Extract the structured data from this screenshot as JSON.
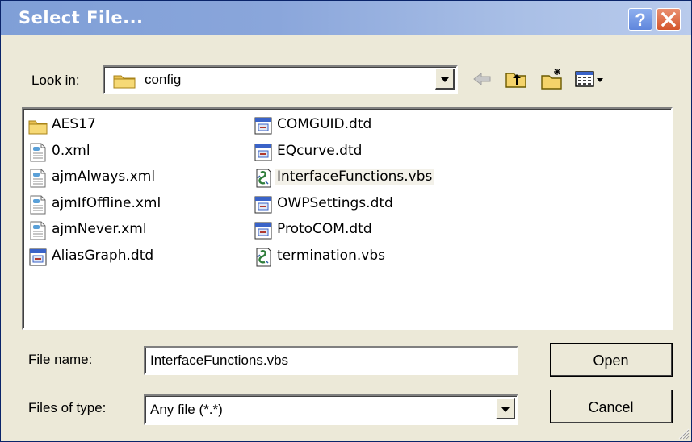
{
  "window": {
    "title": "Select File..."
  },
  "lookin": {
    "label": "Look in:",
    "value": "config"
  },
  "files": [
    {
      "name": "AES17",
      "type": "folder"
    },
    {
      "name": "0.xml",
      "type": "xml"
    },
    {
      "name": "ajmAlways.xml",
      "type": "xml"
    },
    {
      "name": "ajmIfOffline.xml",
      "type": "xml"
    },
    {
      "name": "ajmNever.xml",
      "type": "xml"
    },
    {
      "name": "AliasGraph.dtd",
      "type": "dtd"
    },
    {
      "name": "COMGUID.dtd",
      "type": "dtd"
    },
    {
      "name": "EQcurve.dtd",
      "type": "dtd"
    },
    {
      "name": "InterfaceFunctions.vbs",
      "type": "vbs",
      "selected": true
    },
    {
      "name": "OWPSettings.dtd",
      "type": "dtd"
    },
    {
      "name": "ProtoCOM.dtd",
      "type": "dtd"
    },
    {
      "name": "termination.vbs",
      "type": "vbs"
    }
  ],
  "filename": {
    "label": "File name:",
    "value": "InterfaceFunctions.vbs"
  },
  "filetype": {
    "label": "Files of type:",
    "value": "Any file (*.*)"
  },
  "buttons": {
    "open": "Open",
    "cancel": "Cancel"
  },
  "colors": {
    "titlebar_start": "#7f9fd7",
    "titlebar_end": "#b9cbec",
    "face": "#ece9d8",
    "selection": "#f3f1e9"
  },
  "icons": [
    "help-icon",
    "close-icon",
    "folder-icon",
    "back-arrow-icon",
    "up-folder-icon",
    "new-folder-icon",
    "view-menu-icon",
    "dropdown-arrow-icon",
    "xml-file-icon",
    "dtd-file-icon",
    "vbs-script-icon",
    "size-grip-icon"
  ]
}
